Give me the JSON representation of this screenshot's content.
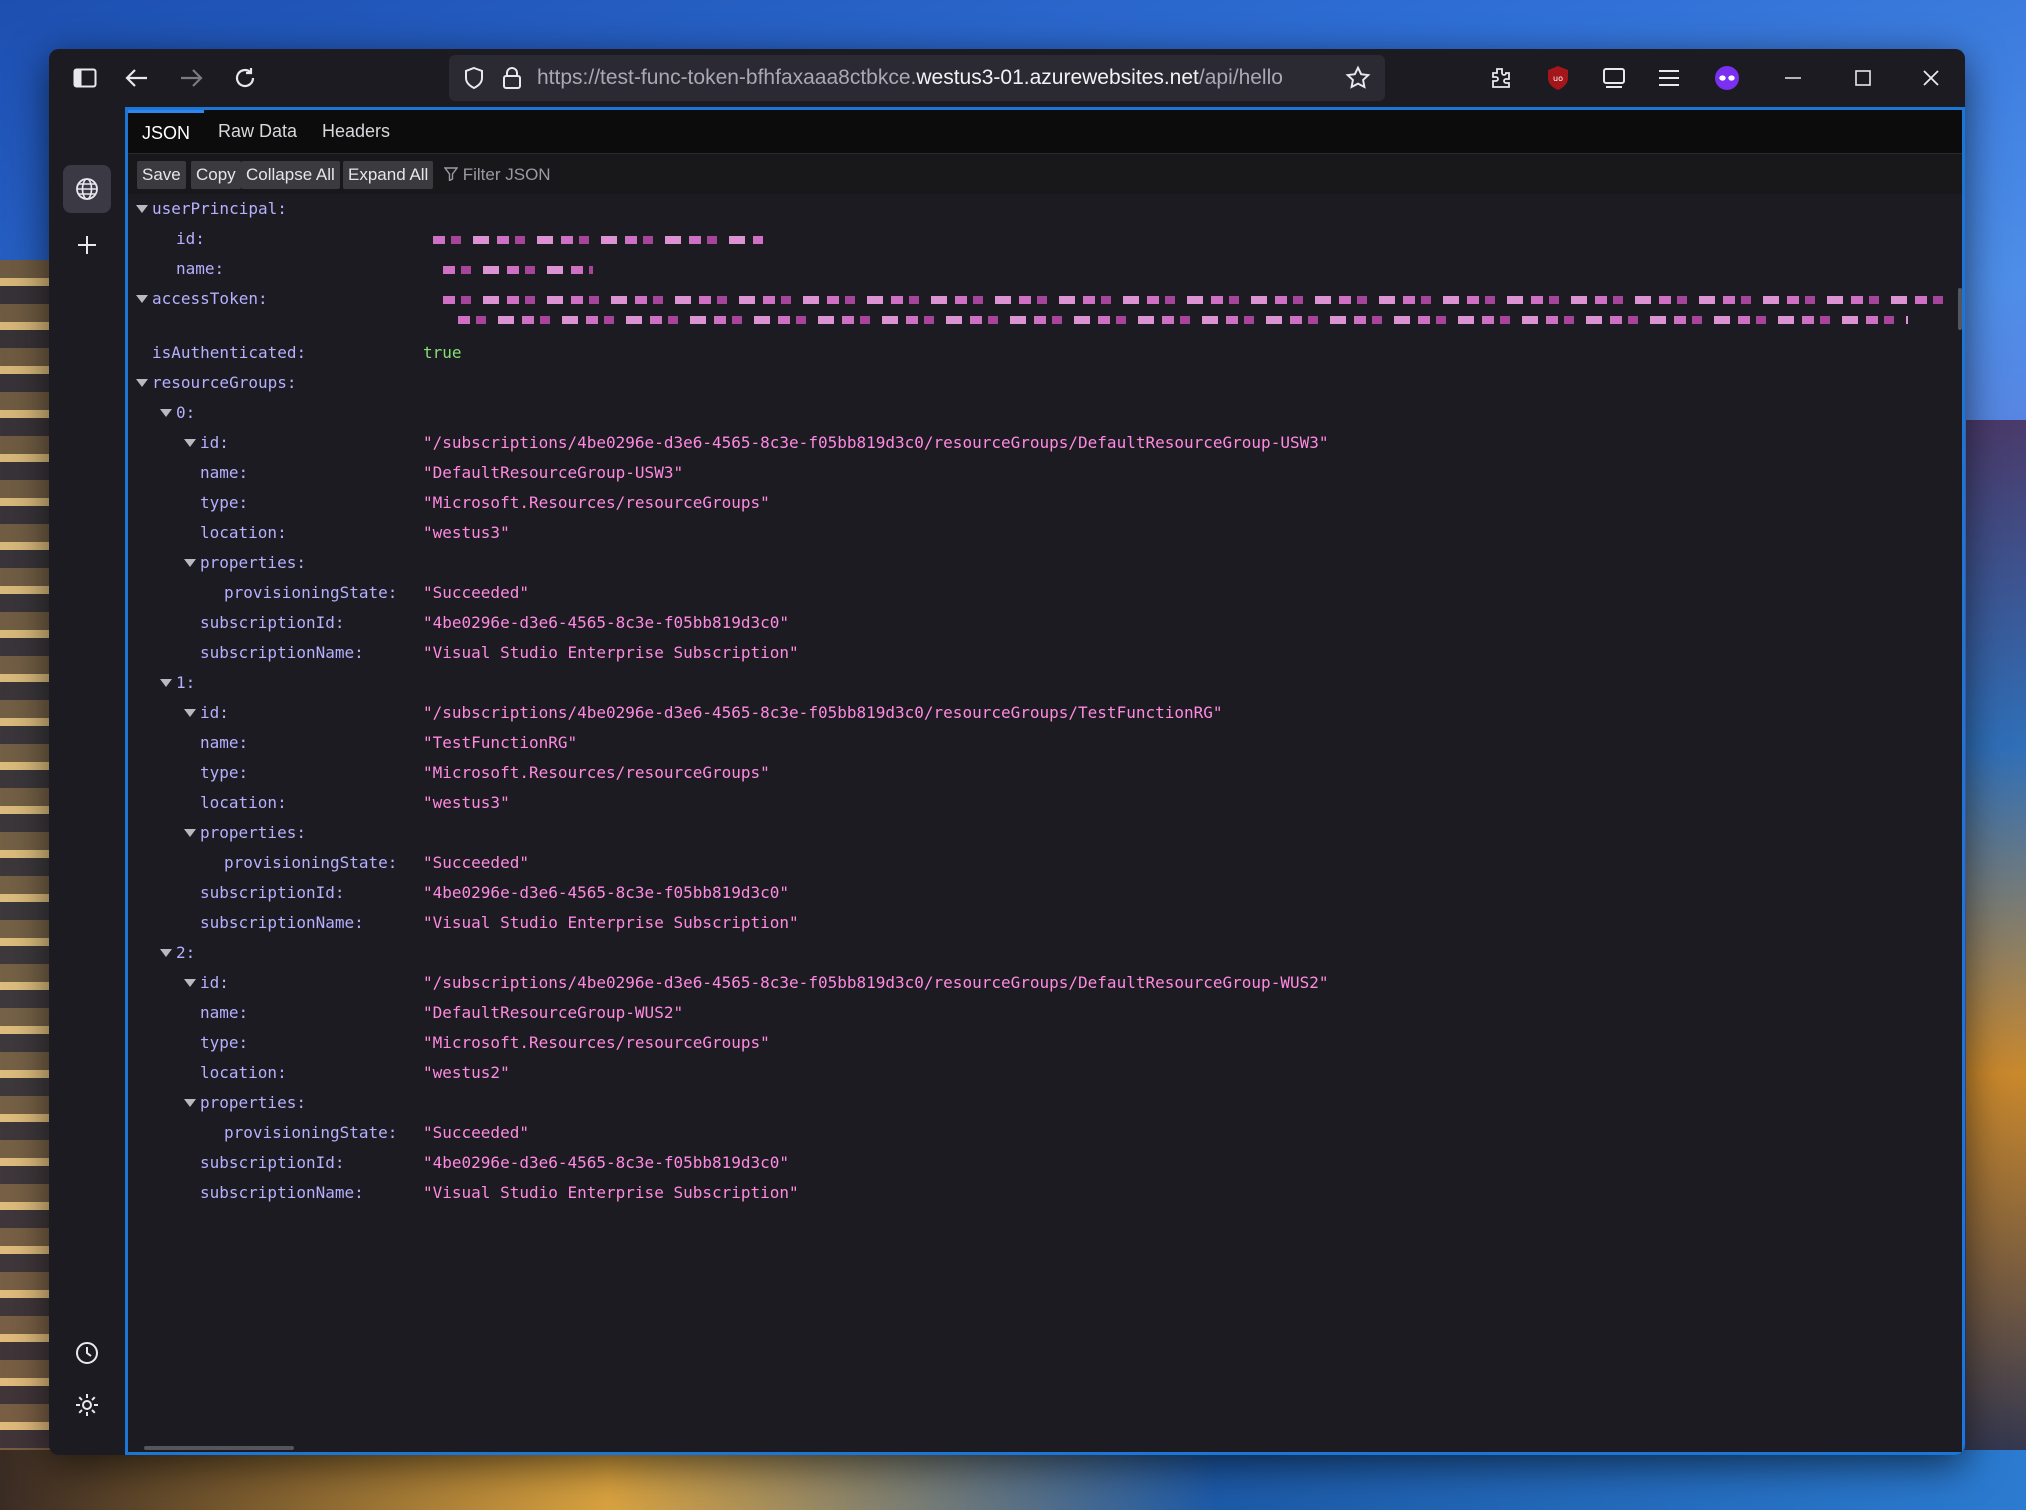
{
  "browser": {
    "url_prefix": "https://test-func-token-bfhfaxaaa8ctbkce.",
    "url_host": "westus3-01.azurewebsites.net",
    "url_path": "/api/hello"
  },
  "viewer": {
    "tabs": [
      "JSON",
      "Raw Data",
      "Headers"
    ],
    "toolbar": {
      "save": "Save",
      "copy": "Copy",
      "collapse_all": "Collapse All",
      "expand_all": "Expand All",
      "filter_placeholder": "Filter JSON"
    }
  },
  "json": {
    "user_principal_key": "userPrincipal:",
    "id_key": "id:",
    "name_key": "name:",
    "access_token_key": "accessToken:",
    "is_authenticated_key": "isAuthenticated:",
    "is_authenticated_val": "true",
    "resource_groups_key": "resourceGroups:",
    "type_key": "type:",
    "location_key": "location:",
    "properties_key": "properties:",
    "provisioning_key": "provisioningState:",
    "subscription_id_key": "subscriptionId:",
    "subscription_name_key": "subscriptionName:",
    "groups": [
      {
        "index": "0:",
        "id": "\"/subscriptions/4be0296e-d3e6-4565-8c3e-f05bb819d3c0/resourceGroups/DefaultResourceGroup-USW3\"",
        "name": "\"DefaultResourceGroup-USW3\"",
        "type": "\"Microsoft.Resources/resourceGroups\"",
        "location": "\"westus3\"",
        "provisioningState": "\"Succeeded\"",
        "subscriptionId": "\"4be0296e-d3e6-4565-8c3e-f05bb819d3c0\"",
        "subscriptionName": "\"Visual Studio Enterprise Subscription\""
      },
      {
        "index": "1:",
        "id": "\"/subscriptions/4be0296e-d3e6-4565-8c3e-f05bb819d3c0/resourceGroups/TestFunctionRG\"",
        "name": "\"TestFunctionRG\"",
        "type": "\"Microsoft.Resources/resourceGroups\"",
        "location": "\"westus3\"",
        "provisioningState": "\"Succeeded\"",
        "subscriptionId": "\"4be0296e-d3e6-4565-8c3e-f05bb819d3c0\"",
        "subscriptionName": "\"Visual Studio Enterprise Subscription\""
      },
      {
        "index": "2:",
        "id": "\"/subscriptions/4be0296e-d3e6-4565-8c3e-f05bb819d3c0/resourceGroups/DefaultResourceGroup-WUS2\"",
        "name": "\"DefaultResourceGroup-WUS2\"",
        "type": "\"Microsoft.Resources/resourceGroups\"",
        "location": "\"westus2\"",
        "provisioningState": "\"Succeeded\"",
        "subscriptionId": "\"4be0296e-d3e6-4565-8c3e-f05bb819d3c0\"",
        "subscriptionName": "\"Visual Studio Enterprise Subscription\""
      }
    ]
  },
  "colors": {
    "accent": "#1c76d8",
    "key": "#b6b0ff",
    "string": "#ff8ae2",
    "boolean": "#86de74"
  }
}
